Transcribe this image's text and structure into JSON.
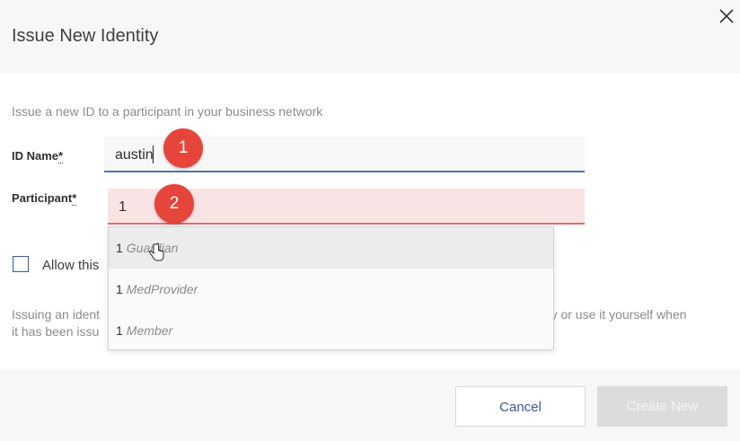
{
  "dialog": {
    "title": "Issue New Identity",
    "intro": "Issue a new ID to a participant in your business network"
  },
  "form": {
    "id_name_label": "ID Name",
    "id_name_req": "*",
    "id_name_value": "austin",
    "participant_label": "Participant",
    "participant_req": "*",
    "participant_value": "1",
    "allow_label": "Allow this",
    "note_line1_a": "Issuing an ident",
    "note_line1_b": "ody or use it yourself when",
    "note_line2": "it has been issu"
  },
  "badges": {
    "step1": "1",
    "step2": "2"
  },
  "dropdown": {
    "items": [
      {
        "id": "1",
        "cls": "Guardian"
      },
      {
        "id": "1",
        "cls": "MedProvider"
      },
      {
        "id": "1",
        "cls": "Member"
      }
    ]
  },
  "buttons": {
    "cancel": "Cancel",
    "create": "Create New"
  },
  "colors": {
    "accent": "#3a5aa0",
    "badge": "#e5453b",
    "error_bg": "#f8e4e4"
  }
}
